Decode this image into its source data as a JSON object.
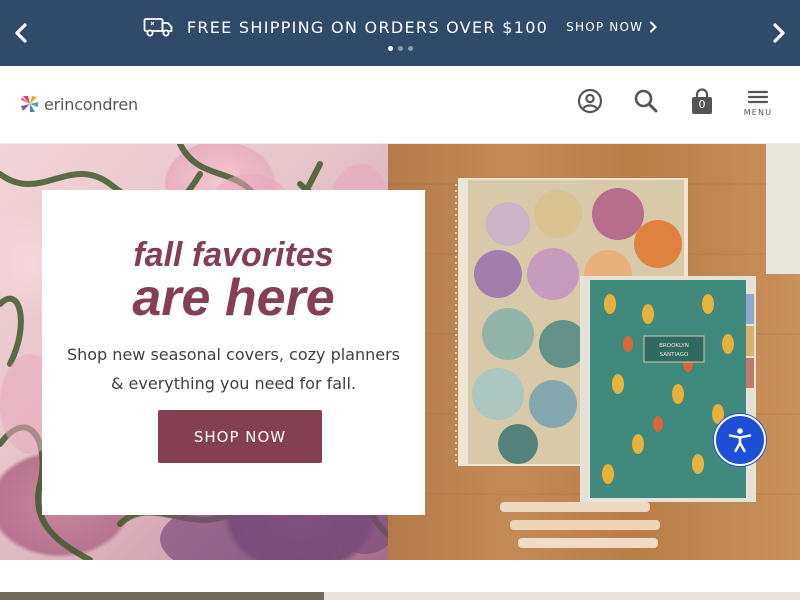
{
  "announcement": {
    "text": "FREE SHIPPING ON ORDERS OVER $100",
    "link_label": "SHOP NOW",
    "icon": "truck-icon",
    "prev_icon": "chevron-left-icon",
    "next_icon": "chevron-right-icon",
    "slide_count": 3,
    "active_slide": 1,
    "bg_color": "#2f4a6a"
  },
  "header": {
    "brand": "erincondren",
    "icons": [
      "account-icon",
      "search-icon",
      "bag-icon",
      "menu-icon"
    ],
    "cart_count": "0",
    "menu_label": "MENU"
  },
  "hero": {
    "headline_line1": "fall favorites",
    "headline_line2": "are here",
    "subtitle": "Shop new seasonal covers, cozy planners & everything you need for fall.",
    "cta_label": "SHOP NOW",
    "planner_label_line1": "BROOKLYN",
    "planner_label_line2": "SANTIAGO",
    "accent_color": "#843f53"
  },
  "accessibility": {
    "icon": "accessibility-icon",
    "color": "#1f4fd6"
  }
}
